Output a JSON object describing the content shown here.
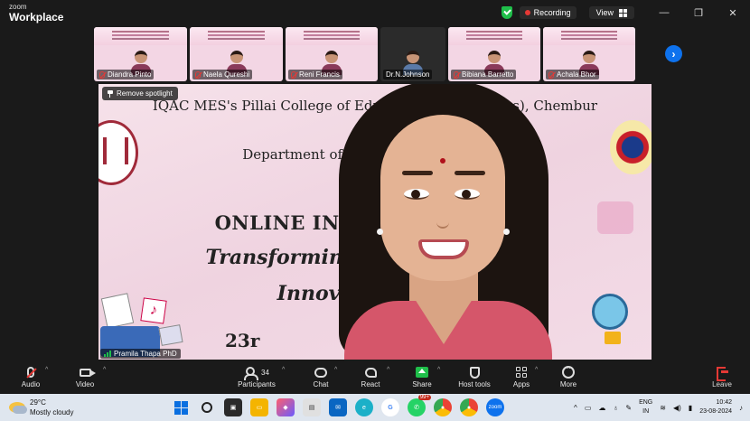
{
  "window": {
    "brand_small": "zoom",
    "brand_big": "Workplace",
    "recording_label": "Recording",
    "view_label": "View",
    "minimize": "—",
    "restore": "❐",
    "close": "✕"
  },
  "gallery": {
    "participants": [
      {
        "name": "Diandra Pinto",
        "muted": true
      },
      {
        "name": "Naela Qureshi",
        "muted": true
      },
      {
        "name": "Reni Francis",
        "muted": true
      },
      {
        "name": "Dr.N.Johnson",
        "muted": false
      },
      {
        "name": "Bibiana Barretto",
        "muted": true
      },
      {
        "name": "Achala Bhor",
        "muted": true
      }
    ],
    "next_label": "›"
  },
  "main_video": {
    "spotlight_label": "Remove spotlight",
    "speaker_name": "Pramila Thapa PhD",
    "slide": {
      "line1": "IQAC MES's Pillai College of Educa          rch (Autonomous), Chembur",
      "line2": "in co",
      "line3": "Department of Lifelo                      happa University",
      "line4": "ONLINE INTER                    ONFERENCE",
      "line5": "Transforming Ed                    : Challenges,",
      "line6": "Innovation                    ations",
      "line7": "23r"
    }
  },
  "toolbar": {
    "audio": "Audio",
    "video": "Video",
    "participants": "Participants",
    "participants_count": "34",
    "chat": "Chat",
    "react": "React",
    "share": "Share",
    "host_tools": "Host tools",
    "apps": "Apps",
    "more": "More",
    "leave": "Leave"
  },
  "taskbar": {
    "temperature": "29°C",
    "weather": "Mostly cloudy",
    "notif_badge": "99+",
    "lang_top": "ENG",
    "lang_bottom": "IN",
    "time": "10:42",
    "date": "23-08-2024"
  }
}
